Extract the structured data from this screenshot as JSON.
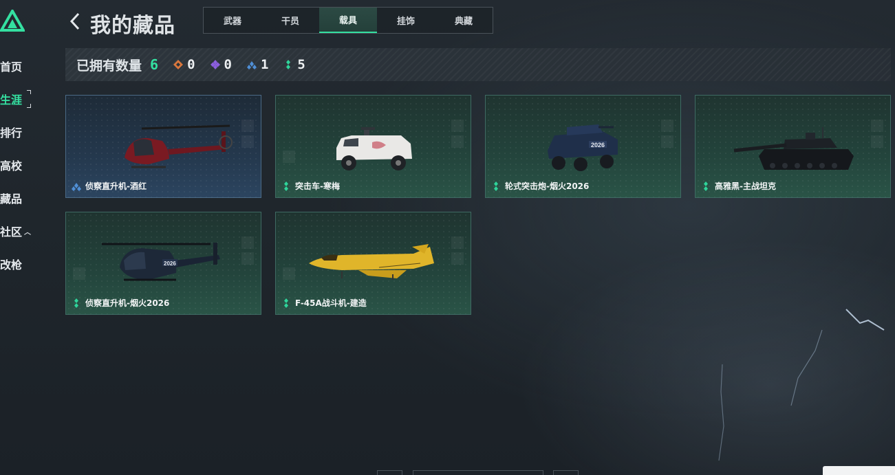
{
  "nav": {
    "items": [
      {
        "label": "首页",
        "active": false
      },
      {
        "label": "生涯",
        "active": true
      },
      {
        "label": "排行",
        "active": false
      },
      {
        "label": "高校",
        "active": false
      },
      {
        "label": "藏品",
        "active": false
      },
      {
        "label": "社区",
        "active": false,
        "expand_icon": "chevron-up-icon"
      },
      {
        "label": "改枪",
        "active": false
      }
    ]
  },
  "header": {
    "title": "我的藏品",
    "tabs": [
      {
        "label": "武器",
        "active": false
      },
      {
        "label": "干员",
        "active": false
      },
      {
        "label": "载具",
        "active": true
      },
      {
        "label": "挂饰",
        "active": false
      },
      {
        "label": "典藏",
        "active": false
      }
    ]
  },
  "stats": {
    "owned_label": "已拥有数量",
    "owned_total": "6",
    "rarities": [
      {
        "icon": "rarity-orange-icon",
        "color": "#d9773d",
        "count": "0"
      },
      {
        "icon": "rarity-purple-icon",
        "color": "#8c5fe0",
        "count": "0"
      },
      {
        "icon": "rarity-blue-icon",
        "color": "#4f8fd6",
        "count": "1"
      },
      {
        "icon": "rarity-green-icon",
        "color": "#2fd49a",
        "count": "5"
      }
    ]
  },
  "cards": [
    {
      "name": "侦察直升机-酒红",
      "rarity": "blue",
      "image": "helicopter-red"
    },
    {
      "name": "突击车-寒梅",
      "rarity": "green",
      "image": "assault-vehicle-white"
    },
    {
      "name": "轮式突击炮-烟火2026",
      "rarity": "green",
      "image": "wheeled-assault-gun"
    },
    {
      "name": "高雅黑-主战坦克",
      "rarity": "green",
      "image": "main-battle-tank"
    },
    {
      "name": "侦察直升机-烟火2026",
      "rarity": "green",
      "image": "helicopter-dark"
    },
    {
      "name": "F-45A战斗机-建造",
      "rarity": "green",
      "image": "fighter-jet-yellow"
    }
  ],
  "colors": {
    "accent": "#34e0a1",
    "card_border_green": "#3f6a63",
    "card_border_blue": "#4b6a86"
  }
}
